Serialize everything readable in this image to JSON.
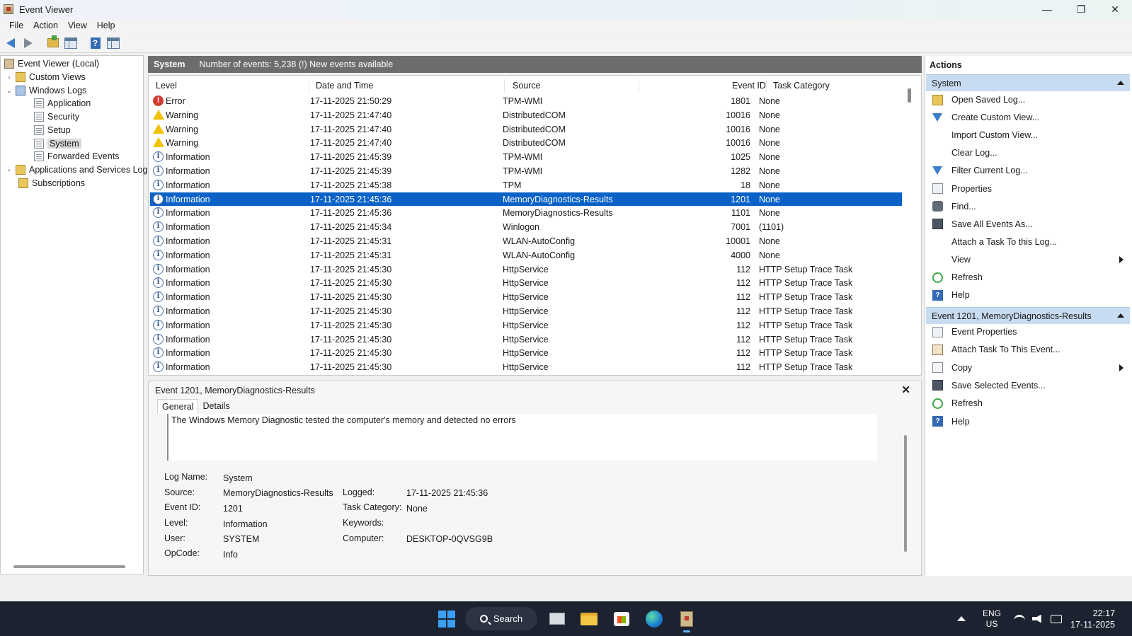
{
  "window": {
    "title": "Event Viewer",
    "minimize": "—",
    "restore": "❐",
    "close": "✕"
  },
  "menu": [
    "File",
    "Action",
    "View",
    "Help"
  ],
  "tree": {
    "root": "Event Viewer (Local)",
    "custom_views": "Custom Views",
    "windows_logs": "Windows Logs",
    "application": "Application",
    "security": "Security",
    "setup": "Setup",
    "system": "System",
    "forwarded": "Forwarded Events",
    "apps_services": "Applications and Services Log",
    "subscriptions": "Subscriptions",
    "twisty_collapsed": "›",
    "twisty_expanded": "⌄"
  },
  "log_header": {
    "name": "System",
    "count_text": "Number of events: 5,238 (!) New events available"
  },
  "columns": {
    "level": "Level",
    "datetime": "Date and Time",
    "source": "Source",
    "event_id": "Event ID",
    "task": "Task Category"
  },
  "events": [
    {
      "level": "Error",
      "icon": "error",
      "datetime": "17-11-2025 21:50:29",
      "source": "TPM-WMI",
      "event_id": "1801",
      "task": "None"
    },
    {
      "level": "Warning",
      "icon": "warning",
      "datetime": "17-11-2025 21:47:40",
      "source": "DistributedCOM",
      "event_id": "10016",
      "task": "None"
    },
    {
      "level": "Warning",
      "icon": "warning",
      "datetime": "17-11-2025 21:47:40",
      "source": "DistributedCOM",
      "event_id": "10016",
      "task": "None"
    },
    {
      "level": "Warning",
      "icon": "warning",
      "datetime": "17-11-2025 21:47:40",
      "source": "DistributedCOM",
      "event_id": "10016",
      "task": "None"
    },
    {
      "level": "Information",
      "icon": "info",
      "datetime": "17-11-2025 21:45:39",
      "source": "TPM-WMI",
      "event_id": "1025",
      "task": "None"
    },
    {
      "level": "Information",
      "icon": "info",
      "datetime": "17-11-2025 21:45:39",
      "source": "TPM-WMI",
      "event_id": "1282",
      "task": "None"
    },
    {
      "level": "Information",
      "icon": "info",
      "datetime": "17-11-2025 21:45:38",
      "source": "TPM",
      "event_id": "18",
      "task": "None"
    },
    {
      "level": "Information",
      "icon": "info",
      "datetime": "17-11-2025 21:45:36",
      "source": "MemoryDiagnostics-Results",
      "event_id": "1201",
      "task": "None",
      "selected": true
    },
    {
      "level": "Information",
      "icon": "info",
      "datetime": "17-11-2025 21:45:36",
      "source": "MemoryDiagnostics-Results",
      "event_id": "1101",
      "task": "None"
    },
    {
      "level": "Information",
      "icon": "info",
      "datetime": "17-11-2025 21:45:34",
      "source": "Winlogon",
      "event_id": "7001",
      "task": "(1101)"
    },
    {
      "level": "Information",
      "icon": "info",
      "datetime": "17-11-2025 21:45:31",
      "source": "WLAN-AutoConfig",
      "event_id": "10001",
      "task": "None"
    },
    {
      "level": "Information",
      "icon": "info",
      "datetime": "17-11-2025 21:45:31",
      "source": "WLAN-AutoConfig",
      "event_id": "4000",
      "task": "None"
    },
    {
      "level": "Information",
      "icon": "info",
      "datetime": "17-11-2025 21:45:30",
      "source": "HttpService",
      "event_id": "112",
      "task": "HTTP Setup Trace Task"
    },
    {
      "level": "Information",
      "icon": "info",
      "datetime": "17-11-2025 21:45:30",
      "source": "HttpService",
      "event_id": "112",
      "task": "HTTP Setup Trace Task"
    },
    {
      "level": "Information",
      "icon": "info",
      "datetime": "17-11-2025 21:45:30",
      "source": "HttpService",
      "event_id": "112",
      "task": "HTTP Setup Trace Task"
    },
    {
      "level": "Information",
      "icon": "info",
      "datetime": "17-11-2025 21:45:30",
      "source": "HttpService",
      "event_id": "112",
      "task": "HTTP Setup Trace Task"
    },
    {
      "level": "Information",
      "icon": "info",
      "datetime": "17-11-2025 21:45:30",
      "source": "HttpService",
      "event_id": "112",
      "task": "HTTP Setup Trace Task"
    },
    {
      "level": "Information",
      "icon": "info",
      "datetime": "17-11-2025 21:45:30",
      "source": "HttpService",
      "event_id": "112",
      "task": "HTTP Setup Trace Task"
    },
    {
      "level": "Information",
      "icon": "info",
      "datetime": "17-11-2025 21:45:30",
      "source": "HttpService",
      "event_id": "112",
      "task": "HTTP Setup Trace Task"
    },
    {
      "level": "Information",
      "icon": "info",
      "datetime": "17-11-2025 21:45:30",
      "source": "HttpService",
      "event_id": "112",
      "task": "HTTP Setup Trace Task"
    }
  ],
  "detail": {
    "title": "Event 1201, MemoryDiagnostics-Results",
    "close": "✕",
    "tabs": [
      "General",
      "Details"
    ],
    "message": "The Windows Memory Diagnostic tested the computer's memory and detected no errors",
    "labels": {
      "log_name": "Log Name:",
      "source": "Source:",
      "event_id": "Event ID:",
      "level": "Level:",
      "user": "User:",
      "opcode": "OpCode:",
      "logged": "Logged:",
      "task": "Task Category:",
      "keywords": "Keywords:",
      "computer": "Computer:"
    },
    "values": {
      "log_name": "System",
      "source": "MemoryDiagnostics-Results",
      "event_id": "1201",
      "level": "Information",
      "user": "SYSTEM",
      "opcode": "Info",
      "logged": "17-11-2025 21:45:36",
      "task": "None",
      "keywords": "",
      "computer": "DESKTOP-0QVSG9B"
    }
  },
  "actions": {
    "title": "Actions",
    "section1": "System",
    "section1_items": [
      {
        "label": "Open Saved Log...",
        "icon": "folder-icon"
      },
      {
        "label": "Create Custom View...",
        "icon": "filter-icon"
      },
      {
        "label": "Import Custom View...",
        "icon": ""
      },
      {
        "label": "Clear Log...",
        "icon": ""
      },
      {
        "label": "Filter Current Log...",
        "icon": "filter-icon"
      },
      {
        "label": "Properties",
        "icon": "properties-icon"
      },
      {
        "label": "Find...",
        "icon": "find-icon"
      },
      {
        "label": "Save All Events As...",
        "icon": "save-icon"
      },
      {
        "label": "Attach a Task To this Log...",
        "icon": ""
      },
      {
        "label": "View",
        "icon": "",
        "submenu": true
      },
      {
        "label": "Refresh",
        "icon": "refresh-icon"
      },
      {
        "label": "Help",
        "icon": "help-icon"
      }
    ],
    "section2": "Event 1201, MemoryDiagnostics-Results",
    "section2_items": [
      {
        "label": "Event Properties",
        "icon": "properties-icon"
      },
      {
        "label": "Attach Task To This Event...",
        "icon": "task-icon"
      },
      {
        "label": "Copy",
        "icon": "copy-icon",
        "submenu": true
      },
      {
        "label": "Save Selected Events...",
        "icon": "save-icon"
      },
      {
        "label": "Refresh",
        "icon": "refresh-icon"
      },
      {
        "label": "Help",
        "icon": "help-icon"
      }
    ]
  },
  "taskbar": {
    "search_label": "Search",
    "lang": "ENG",
    "region": "US",
    "time": "22:17",
    "date": "17-11-2025"
  }
}
